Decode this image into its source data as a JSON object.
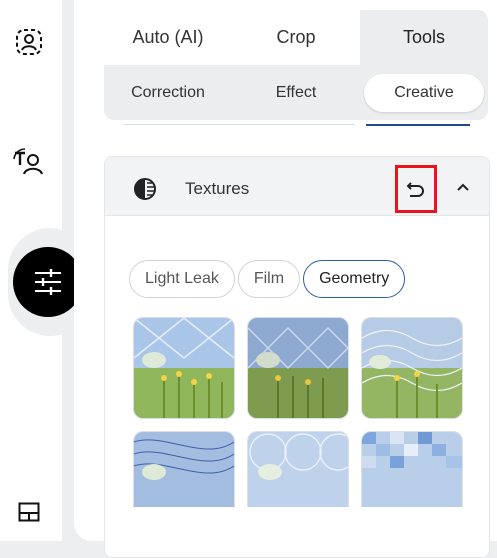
{
  "rail": {
    "icons": [
      "portrait-icon",
      "text-person-icon",
      "sliders-icon",
      "layout-icon"
    ]
  },
  "tabs": {
    "main": [
      {
        "label": "Auto (AI)",
        "active": false
      },
      {
        "label": "Crop",
        "active": false
      },
      {
        "label": "Tools",
        "active": true
      }
    ],
    "sub": [
      {
        "label": "Correction",
        "active": false
      },
      {
        "label": "Effect",
        "active": false
      },
      {
        "label": "Creative",
        "active": true
      }
    ]
  },
  "textures": {
    "title": "Textures",
    "icon": "textures-icon",
    "reset_icon": "undo-icon",
    "collapse_icon": "chevron-up-icon",
    "chips": [
      {
        "label": "Light Leak",
        "active": false
      },
      {
        "label": "Film",
        "active": false
      },
      {
        "label": "Geometry",
        "active": true
      }
    ],
    "thumbnails": [
      "triangles",
      "triangles-dense",
      "waves",
      "lines-net",
      "circles",
      "pixels"
    ]
  },
  "colors": {
    "accent": "#2b5ea4",
    "highlight": "#e8131d",
    "fab": "#000000"
  }
}
